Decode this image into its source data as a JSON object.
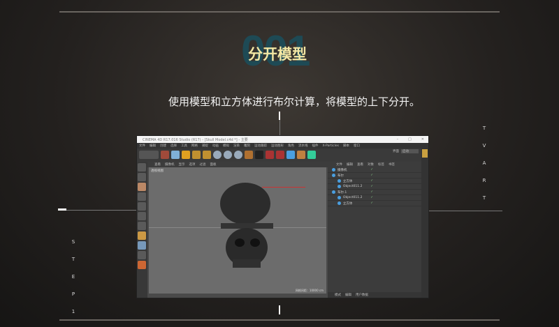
{
  "header": {
    "number": "001",
    "title": "分开模型",
    "description": "使用模型和立方体进行布尔计算，将模型的上下分开。"
  },
  "side_left": [
    "S",
    "T",
    "E",
    "P",
    "1"
  ],
  "side_right": [
    "T",
    "V",
    "A",
    "R",
    "T"
  ],
  "app": {
    "title": "CINEMA 4D R17.016 Studio (R17) - [Skull Model.c4d *] - 主要",
    "menu": [
      "文件",
      "编辑",
      "创建",
      "选择",
      "工具",
      "网格",
      "捕捉",
      "动画",
      "模拟",
      "渲染",
      "雕刻",
      "运动跟踪",
      "运动图形",
      "角色",
      "流水线",
      "插件",
      "X-Particles",
      "脚本",
      "窗口"
    ],
    "layout_label": "界面",
    "layout_value": "启动",
    "viewport_menu": [
      "查看",
      "摄像机",
      "显示",
      "选项",
      "过滤",
      "面板"
    ],
    "viewport_name": "透视视图",
    "grid_spacing": "网格间距：10000 cm",
    "om_menu": [
      "文件",
      "编辑",
      "查看",
      "对象",
      "标签",
      "书签"
    ],
    "objects": [
      {
        "name": "摄像机",
        "depth": 0
      },
      {
        "name": "布尔",
        "depth": 0
      },
      {
        "name": "立方体",
        "depth": 1
      },
      {
        "name": "Object011.2",
        "depth": 1
      },
      {
        "name": "布尔.1",
        "depth": 0
      },
      {
        "name": "Object011.2",
        "depth": 1
      },
      {
        "name": "立方体",
        "depth": 1
      }
    ],
    "attr_tabs": [
      "模式",
      "编辑",
      "用户数据"
    ]
  }
}
